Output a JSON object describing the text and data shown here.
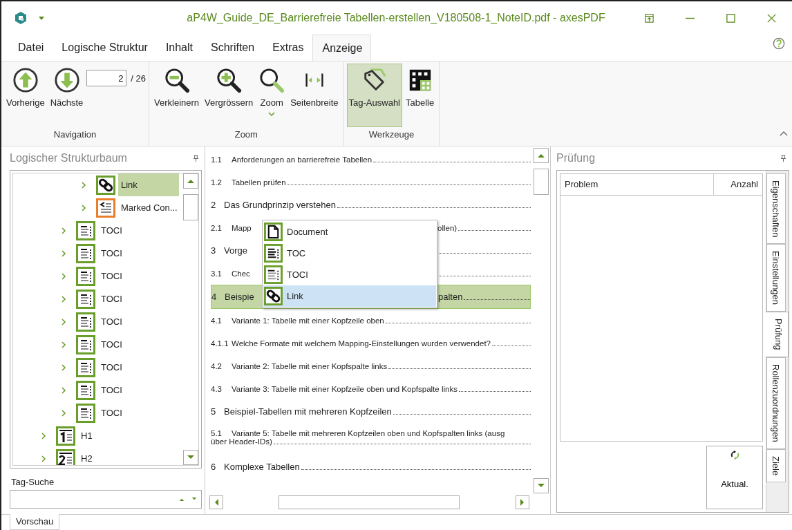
{
  "window": {
    "title": "aP4W_Guide_DE_Barrierefreie Tabellen-erstellen_V180508-1_NoteID.pdf - axesPDF"
  },
  "menu_tabs": [
    {
      "label": "Datei",
      "selected": false
    },
    {
      "label": "Logische Struktur",
      "selected": false
    },
    {
      "label": "Inhalt",
      "selected": false
    },
    {
      "label": "Schriften",
      "selected": false
    },
    {
      "label": "Extras",
      "selected": false
    },
    {
      "label": "Anzeige",
      "selected": true
    }
  ],
  "ribbon": {
    "groups": [
      {
        "title": "Navigation",
        "buttons": [
          {
            "label": "Vorherige",
            "kind": "up",
            "selected": false
          },
          {
            "label": "Nächste",
            "kind": "down",
            "selected": false
          }
        ],
        "page_field": {
          "value": "2",
          "total": "/ 26"
        }
      },
      {
        "title": "Zoom",
        "buttons": [
          {
            "label": "Verkleinern",
            "kind": "zoom-out",
            "selected": false
          },
          {
            "label": "Vergrössern",
            "kind": "zoom-in",
            "selected": false
          },
          {
            "label": "Zoom",
            "kind": "zoom",
            "selected": false,
            "dropdown": true
          },
          {
            "label": "Seitenbreite",
            "kind": "page-width",
            "selected": false
          }
        ]
      },
      {
        "title": "Werkzeuge",
        "buttons": [
          {
            "label": "Tag-Auswahl",
            "kind": "tag",
            "selected": true
          },
          {
            "label": "Tabelle",
            "kind": "table",
            "selected": false
          }
        ]
      }
    ]
  },
  "structure_panel": {
    "title": "Logischer Strukturbaum",
    "tree": [
      {
        "children": [
          {
            "children": [
              {
                "label": "Link",
                "kind": "link",
                "selected": true
              },
              {
                "label": "Marked Con...",
                "kind": "marked-content",
                "selected": false
              }
            ]
          },
          {
            "label": "TOCI",
            "kind": "toci",
            "selected": false
          },
          {
            "label": "TOCI",
            "kind": "toci",
            "selected": false
          },
          {
            "label": "TOCI",
            "kind": "toci",
            "selected": false
          },
          {
            "label": "TOCI",
            "kind": "toci",
            "selected": false
          },
          {
            "label": "TOCI",
            "kind": "toci",
            "selected": false
          },
          {
            "label": "TOCI",
            "kind": "toci",
            "selected": false
          },
          {
            "label": "TOCI",
            "kind": "toci",
            "selected": false
          },
          {
            "label": "TOCI",
            "kind": "toci",
            "selected": false
          },
          {
            "label": "TOCI",
            "kind": "toci",
            "selected": false
          }
        ]
      },
      {
        "label": "H1",
        "kind": "h1",
        "selected": false
      },
      {
        "label": "H2",
        "kind": "h2",
        "selected": false
      }
    ],
    "search_label": "Tag-Suche"
  },
  "document": {
    "rows": [
      {
        "number": "1.1",
        "text": "Anforderungen an barrierefreie Tabellen",
        "kind": "section",
        "selected": false
      },
      {
        "number": "1.2",
        "text": "Tabellen prüfen",
        "kind": "section",
        "selected": false
      },
      {
        "number": "2",
        "text": "Das Grundprinzip verstehen",
        "kind": "chapter",
        "selected": false
      },
      {
        "number": "2.1",
        "text": "Mapp",
        "text_after": "ollen)",
        "kind": "section",
        "selected": false
      },
      {
        "number": "3",
        "text": "Vorge",
        "kind": "chapter",
        "selected": false,
        "covered": true
      },
      {
        "number": "3.1",
        "text": "Chec",
        "kind": "section",
        "selected": false,
        "covered": true
      },
      {
        "number": "4",
        "text": "Beispie",
        "text_after": "palten",
        "kind": "chapter",
        "selected": true
      },
      {
        "number": "4.1",
        "text": "Variante 1: Tabelle mit einer Kopfzeile oben",
        "kind": "section",
        "selected": false
      },
      {
        "number": "4.1.1",
        "text": "Welche Formate mit welchem Mapping-Einstellungen wurden verwendet?",
        "kind": "section",
        "selected": false
      },
      {
        "number": "4.2",
        "text": "Variante 2: Tabelle mit einer Kopfspalte links",
        "kind": "section",
        "selected": false
      },
      {
        "number": "4.3",
        "text": "Variante 3: Tabelle mit einer Kopfzeile oben und Kopfspalte links",
        "kind": "section",
        "selected": false
      },
      {
        "number": "5",
        "text": "Beispiel-Tabellen mit mehreren Kopfzeilen",
        "kind": "chapter",
        "selected": false
      },
      {
        "number": "5.1",
        "text": "Variante 5: Tabelle mit mehreren Kopfzeilen oben und Kopfspalten links (ausg",
        "continuation": "über Header-IDs)",
        "kind": "section",
        "selected": false
      },
      {
        "number": "6",
        "text": "Komplexe Tabellen",
        "kind": "chapter",
        "selected": false
      }
    ],
    "popup_menu": [
      {
        "label": "Document",
        "kind": "document",
        "selected": false
      },
      {
        "label": "TOC",
        "kind": "toc",
        "selected": false
      },
      {
        "label": "TOCI",
        "kind": "toci",
        "selected": false
      },
      {
        "label": "Link",
        "kind": "link",
        "selected": true
      }
    ]
  },
  "check_panel": {
    "title": "Prüfung",
    "columns": [
      "Problem",
      "Anzahl"
    ],
    "refresh_button": "Aktual.",
    "side_tabs": [
      {
        "label": "Eigenschaften",
        "selected": false
      },
      {
        "label": "Einstellungen",
        "selected": false
      },
      {
        "label": "Prüfung",
        "selected": true
      },
      {
        "label": "Rollenzuordnungen",
        "selected": false
      },
      {
        "label": "Ziele",
        "selected": false
      }
    ]
  },
  "bottom_tabs": [
    {
      "label": "Vorschau",
      "selected": true
    }
  ]
}
